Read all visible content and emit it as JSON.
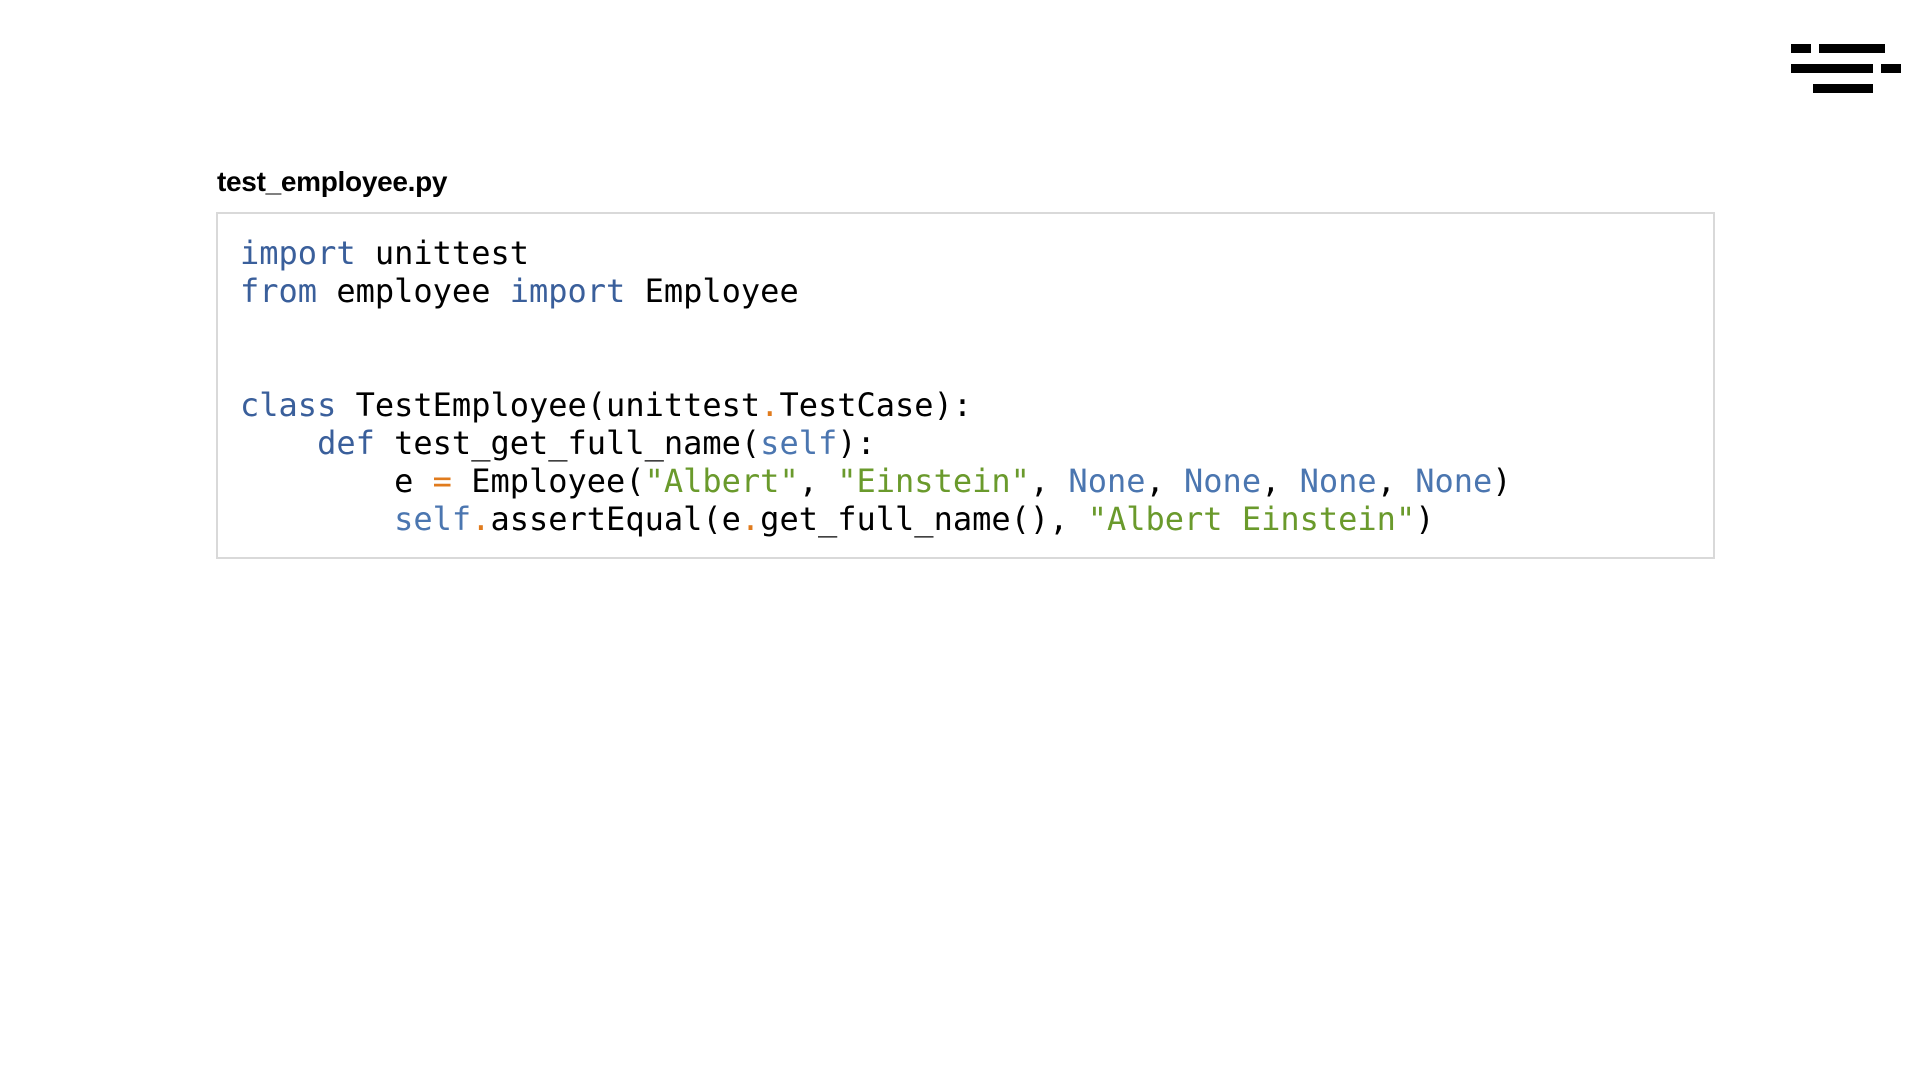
{
  "file": {
    "name": "test_employee.py"
  },
  "logo": {
    "icon": "lines-logo-icon",
    "color": "#000000"
  },
  "colors": {
    "keyword": "#3a5f9b",
    "operator": "#e07b1d",
    "string": "#6a9a2c",
    "builtin": "#4b76b0",
    "text": "#000000",
    "border": "#d9d9d9"
  },
  "code": {
    "lines": [
      [
        {
          "t": "import",
          "c": "kw"
        },
        {
          "t": " unittest",
          "c": "plain"
        }
      ],
      [
        {
          "t": "from",
          "c": "kw"
        },
        {
          "t": " employee ",
          "c": "plain"
        },
        {
          "t": "import",
          "c": "kw"
        },
        {
          "t": " Employee",
          "c": "plain"
        }
      ],
      [],
      [],
      [
        {
          "t": "class",
          "c": "kw"
        },
        {
          "t": " TestEmployee(unittest",
          "c": "plain"
        },
        {
          "t": ".",
          "c": "op"
        },
        {
          "t": "TestCase):",
          "c": "plain"
        }
      ],
      [
        {
          "t": "    ",
          "c": "plain"
        },
        {
          "t": "def",
          "c": "kw"
        },
        {
          "t": " test_get_full_name(",
          "c": "plain"
        },
        {
          "t": "self",
          "c": "bi"
        },
        {
          "t": "):",
          "c": "plain"
        }
      ],
      [
        {
          "t": "        e ",
          "c": "plain"
        },
        {
          "t": "=",
          "c": "op"
        },
        {
          "t": " Employee(",
          "c": "plain"
        },
        {
          "t": "\"Albert\"",
          "c": "str"
        },
        {
          "t": ", ",
          "c": "plain"
        },
        {
          "t": "\"Einstein\"",
          "c": "str"
        },
        {
          "t": ", ",
          "c": "plain"
        },
        {
          "t": "None",
          "c": "bi"
        },
        {
          "t": ", ",
          "c": "plain"
        },
        {
          "t": "None",
          "c": "bi"
        },
        {
          "t": ", ",
          "c": "plain"
        },
        {
          "t": "None",
          "c": "bi"
        },
        {
          "t": ", ",
          "c": "plain"
        },
        {
          "t": "None",
          "c": "bi"
        },
        {
          "t": ")",
          "c": "plain"
        }
      ],
      [
        {
          "t": "        ",
          "c": "plain"
        },
        {
          "t": "self",
          "c": "bi"
        },
        {
          "t": ".",
          "c": "op"
        },
        {
          "t": "assertEqual(e",
          "c": "plain"
        },
        {
          "t": ".",
          "c": "op"
        },
        {
          "t": "get_full_name(), ",
          "c": "plain"
        },
        {
          "t": "\"Albert Einstein\"",
          "c": "str"
        },
        {
          "t": ")",
          "c": "plain"
        }
      ]
    ]
  }
}
